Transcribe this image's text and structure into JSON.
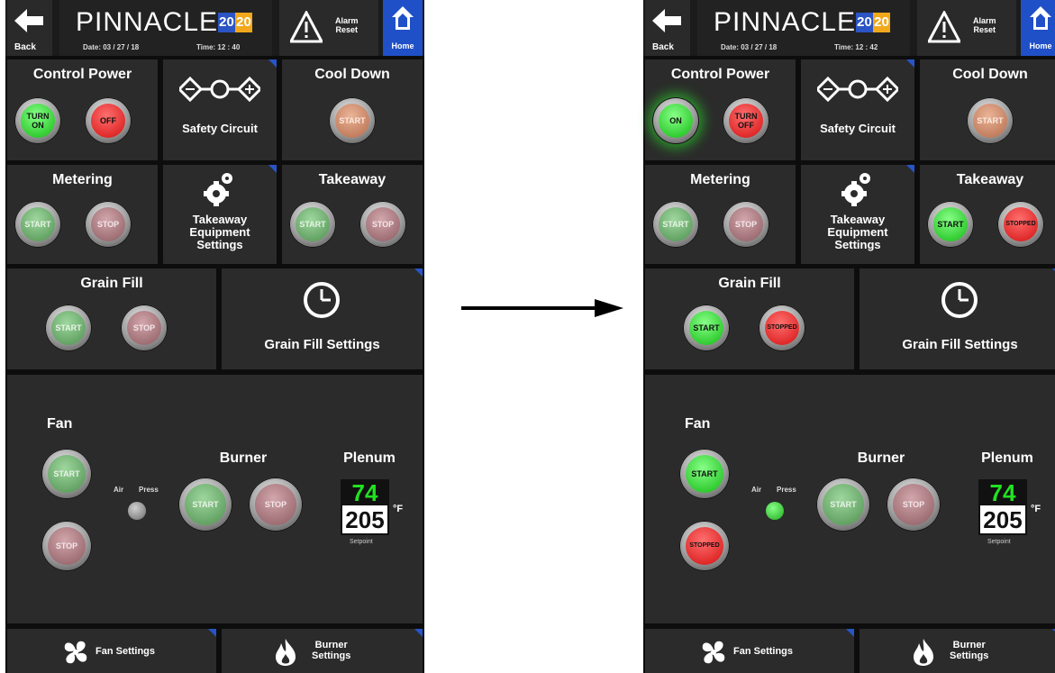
{
  "header": {
    "back_label": "Back",
    "brand": "PINNACLE",
    "year_left": "20",
    "year_right": "20",
    "alarm_label_1": "Alarm",
    "alarm_label_2": "Reset",
    "home_label": "Home"
  },
  "panels": [
    {
      "date": "Date: 03 / 27 / 18",
      "time": "Time: 12 : 40",
      "control_power": {
        "title": "Control Power",
        "left_label": "TURN\nON",
        "right_label": "OFF"
      },
      "safety_circuit": "Safety Circuit",
      "cool_down": {
        "title": "Cool Down",
        "label": "START"
      },
      "metering": {
        "title": "Metering",
        "start": "START",
        "stop": "STOP"
      },
      "takeaway_settings": [
        "Takeaway",
        "Equipment",
        "Settings"
      ],
      "takeaway": {
        "title": "Takeaway",
        "start": "START",
        "stop": "STOP"
      },
      "grain_fill": {
        "title": "Grain Fill",
        "start": "START",
        "stop": "STOP"
      },
      "grain_fill_settings": "Grain Fill Settings",
      "fan": {
        "title": "Fan",
        "start": "START",
        "stop": "STOP"
      },
      "air_press": {
        "air": "Air",
        "press": "Press"
      },
      "burner": {
        "title": "Burner",
        "start": "START",
        "stop": "STOP"
      },
      "plenum": {
        "title": "Plenum",
        "current": "74",
        "setpoint": "205",
        "unit": "°F",
        "setpoint_label": "Setpoint"
      },
      "footer": {
        "fan_settings": "Fan Settings",
        "burner_settings_1": "Burner",
        "burner_settings_2": "Settings"
      }
    },
    {
      "date": "Date: 03 / 27 / 18",
      "time": "Time: 12 : 42",
      "control_power": {
        "title": "Control Power",
        "left_label": "ON",
        "right_label": "TURN\nOFF"
      },
      "safety_circuit": "Safety Circuit",
      "cool_down": {
        "title": "Cool Down",
        "label": "START"
      },
      "metering": {
        "title": "Metering",
        "start": "START",
        "stop": "STOP"
      },
      "takeaway_settings": [
        "Takeaway",
        "Equipment",
        "Settings"
      ],
      "takeaway": {
        "title": "Takeaway",
        "start": "START",
        "stop": "STOPPED"
      },
      "grain_fill": {
        "title": "Grain Fill",
        "start": "START",
        "stop": "STOPPED"
      },
      "grain_fill_settings": "Grain Fill Settings",
      "fan": {
        "title": "Fan",
        "start": "START",
        "stop": "STOPPED"
      },
      "air_press": {
        "air": "Air",
        "press": "Press"
      },
      "burner": {
        "title": "Burner",
        "start": "START",
        "stop": "STOP"
      },
      "plenum": {
        "title": "Plenum",
        "current": "74",
        "setpoint": "205",
        "unit": "°F",
        "setpoint_label": "Setpoint"
      },
      "footer": {
        "fan_settings": "Fan Settings",
        "burner_settings_1": "Burner",
        "burner_settings_2": "Settings"
      }
    }
  ]
}
